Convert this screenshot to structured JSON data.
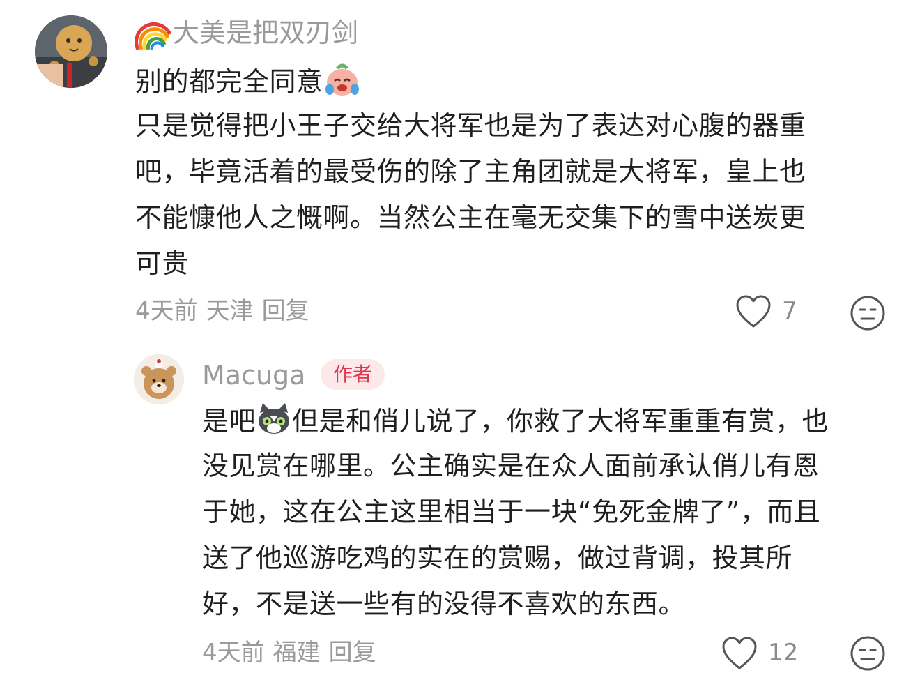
{
  "comment1": {
    "avatar_icon": "avatar-photo-icon",
    "rainbow_icon": "rainbow-emoji",
    "username": "大美是把双刃剑",
    "line1": "别的都完全同意",
    "emoji1": "crying-laughing-peach-emoji",
    "lines": [
      "只是觉得把小王子交给大将军也是为了表达对心腹的器重",
      "吧，毕竟活着的最受伤的除了主角团就是大将军，皇上也",
      "不能慷他人之慨啊。当然公主在毫无交集下的雪中送炭更",
      "可贵"
    ],
    "time": "4天前",
    "location": "天津",
    "reply_label": "回复",
    "like_count": "7",
    "like_icon": "heart-outline-icon",
    "dislike_icon": "unhappy-face-icon"
  },
  "comment2": {
    "avatar_icon": "bear-avatar-icon",
    "username": "Macuga",
    "author_tag": "作者",
    "line1a": "是吧",
    "emoji1": "shocked-cat-emoji",
    "line1b": "但是和俏儿说了，你救了大将军重重有赏，也",
    "lines": [
      "没见赏在哪里。公主确实是在众人面前承认俏儿有恩",
      "于她，这在公主这里相当于一块“免死金牌了”，而且",
      "送了他巡游吃鸡的实在的赏赐，做过背调，投其所",
      "好，不是送一些有的没得不喜欢的东西。"
    ],
    "time": "4天前",
    "location": "福建",
    "reply_label": "回复",
    "like_count": "12",
    "like_icon": "heart-outline-icon",
    "dislike_icon": "unhappy-face-icon"
  },
  "colors": {
    "meta_gray": "#9a9a9a",
    "text": "#1f1f1f",
    "author_tag_bg": "#fde8ea",
    "author_tag_text": "#e3354d"
  }
}
